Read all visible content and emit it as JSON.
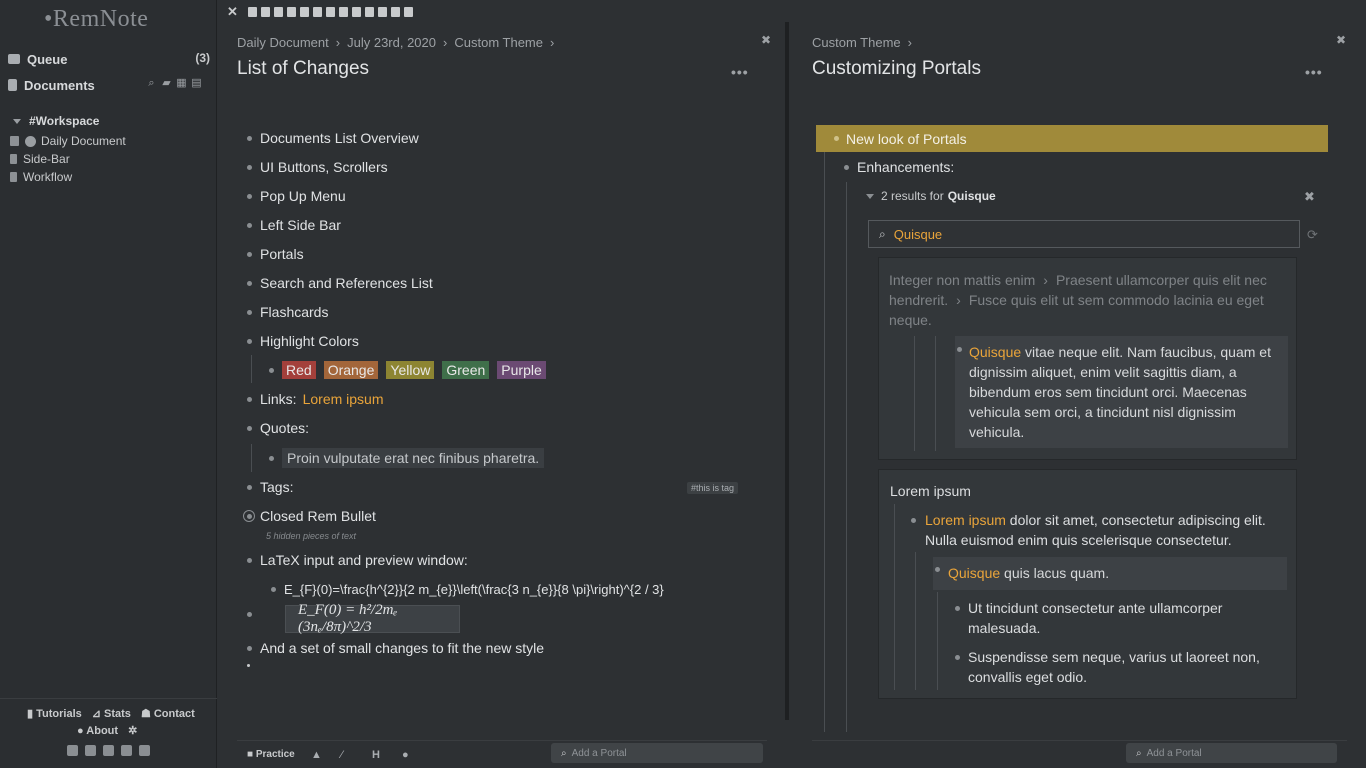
{
  "sidebar": {
    "logo": "•RemNote",
    "queue_label": "Queue",
    "queue_count": "(3)",
    "documents_label": "Documents",
    "workspace_label": "#Workspace",
    "tree": [
      {
        "label": "Daily Document"
      },
      {
        "label": "Side-Bar"
      },
      {
        "label": "Workflow"
      }
    ],
    "footer": {
      "tutorials": "Tutorials",
      "stats": "Stats",
      "contact": "Contact",
      "about": "About"
    }
  },
  "left_pane": {
    "breadcrumb": [
      "Daily Document",
      "July 23rd, 2020",
      "Custom Theme"
    ],
    "title": "List of Changes",
    "items": [
      "Documents List Overview",
      "UI Buttons, Scrollers",
      "Pop Up Menu",
      "Left Side Bar",
      "Portals",
      "Search and References List",
      "Flashcards",
      "Highlight Colors"
    ],
    "colors": [
      "Red",
      "Orange",
      "Yellow",
      "Green",
      "Purple"
    ],
    "links_label": "Links:",
    "link_text": "Lorem ipsum",
    "quotes_label": "Quotes:",
    "quote_text": "Proin vulputate erat nec finibus pharetra.",
    "tags_label": "Tags:",
    "tag_text": "#this is tag",
    "closed_label": "Closed Rem Bullet",
    "hidden_note": "5 hidden pieces of text",
    "latex_label": "LaTeX input and preview window:",
    "latex_source": "E_{F}(0)=\\frac{h^{2}}{2 m_{e}}\\left(\\frac{3 n_{e}}{8 \\pi}\\right)^{2 / 3}",
    "latex_preview": "E_F(0) = h²/2mₑ (3nₑ/8π)^2/3",
    "final_item": "And a set of small changes to fit the new style",
    "bottom": {
      "practice": "Practice",
      "portal_placeholder": "Add a Portal"
    }
  },
  "right_pane": {
    "breadcrumb": [
      "Custom Theme"
    ],
    "title": "Customizing Portals",
    "highlight_item": "New look of Portals",
    "enhancements": "Enhancements:",
    "results_prefix": "2 results for",
    "results_query": "Quisque",
    "search_value": "Quisque",
    "card1": {
      "path1": "Integer non mattis enim",
      "path2": "Praesent ullamcorper quis elit nec hendrerit.",
      "path3": "Fusce quis elit ut sem commodo lacinia eu eget neque.",
      "highlight": "Quisque",
      "text": " vitae neque elit. Nam faucibus, quam et dignissim aliquet, enim velit sagittis diam, a bibendum eros sem tincidunt orci. Maecenas vehicula sem orci, a tincidunt nisl dignissim vehicula."
    },
    "card2": {
      "heading": "Lorem ipsum",
      "lead_link": "Lorem ipsum",
      "lead_text": " dolor sit amet, consectetur adipiscing elit. Nulla euismod enim quis scelerisque consectetur.",
      "quisque": "Quisque",
      "quisque_text": " quis lacus quam.",
      "sub1": "Ut tincidunt consectetur ante ullamcorper malesuada.",
      "sub2": "Suspendisse sem neque, varius ut laoreet non, convallis eget odio."
    },
    "bottom": {
      "portal_placeholder": "Add a Portal"
    }
  }
}
